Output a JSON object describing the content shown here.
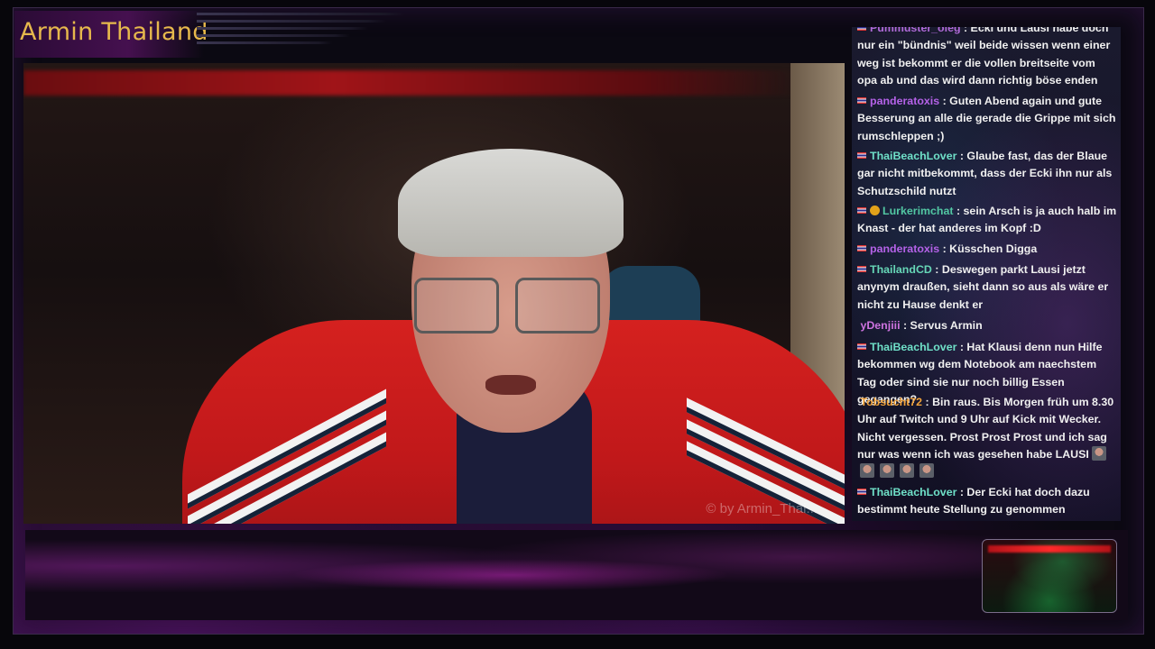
{
  "stream": {
    "title": "Armin Thailand",
    "watermark": "© by Armin_Thai..."
  },
  "chat": {
    "messages": [
      {
        "user": "Pummuster_oleg",
        "badge": "thai-flag-icon",
        "name_color": "#b06ad8",
        "text": ": Ecki und Lausi habe doch nur ein \"bündnis\" weil beide wissen wenn einer weg ist bekommt er die vollen breitseite vom opa ab und das wird dann richtig böse enden"
      },
      {
        "user": "panderatoxis",
        "badge": "thai-flag-icon",
        "name_color": "#b562e8",
        "text": ": Guten Abend again und gute Besserung an alle die gerade die Grippe mit sich rumschleppen ;)"
      },
      {
        "user": "ThaiBeachLover",
        "badge": "thai-flag-icon",
        "name_color": "#6fe0c8",
        "text": ": Glaube fast, das der Blaue gar nicht mitbekommt, dass der Ecki ihn nur als Schutzschild nutzt"
      },
      {
        "user": "Lurkerimchat",
        "badge": "thai-flag-icon",
        "extra_badge": "gold-badge-icon",
        "name_color": "#52c7a3",
        "text": ": sein Arsch is ja auch halb im Knast - der hat anderes im Kopf :D"
      },
      {
        "user": "panderatoxis",
        "badge": "thai-flag-icon",
        "name_color": "#b562e8",
        "text": ": Küsschen Digga"
      },
      {
        "user": "ThailandCD",
        "badge": "thai-flag-icon",
        "name_color": "#66d7b7",
        "text": ": Deswegen parkt Lausi jetzt anynym draußen, sieht dann so aus als wäre er nicht zu Hause denkt er"
      },
      {
        "user": "yDenjiii",
        "badge": "",
        "name_color": "#ce73e0",
        "text": ": Servus Armin"
      },
      {
        "user": "ThaiBeachLover",
        "badge": "thai-flag-icon",
        "name_color": "#6fe0c8",
        "text": ": Hat Klausi denn nun Hilfe bekommen wg dem Notebook am naechstem Tag oder sind sie nur noch billig Essen gegangen?"
      },
      {
        "user": "Tobsucht72",
        "badge": "",
        "name_color": "#f0a23a",
        "text": ": Bin raus. Bis Morgen früh um 8.30 Uhr auf Twitch und 9 Uhr auf Kick mit Wecker. Nicht vergessen. Prost Prost Prost und ich sag nur was wenn ich was gesehen habe LAUSI"
      },
      {
        "user": "ThaiBeachLover",
        "badge": "thai-flag-icon",
        "name_color": "#6fe0c8",
        "text": ": Der Ecki hat doch dazu bestimmt heute Stellung zu genommen"
      }
    ]
  },
  "colors": {
    "title": "#e6b84c",
    "frame_accent": "#45104f"
  }
}
